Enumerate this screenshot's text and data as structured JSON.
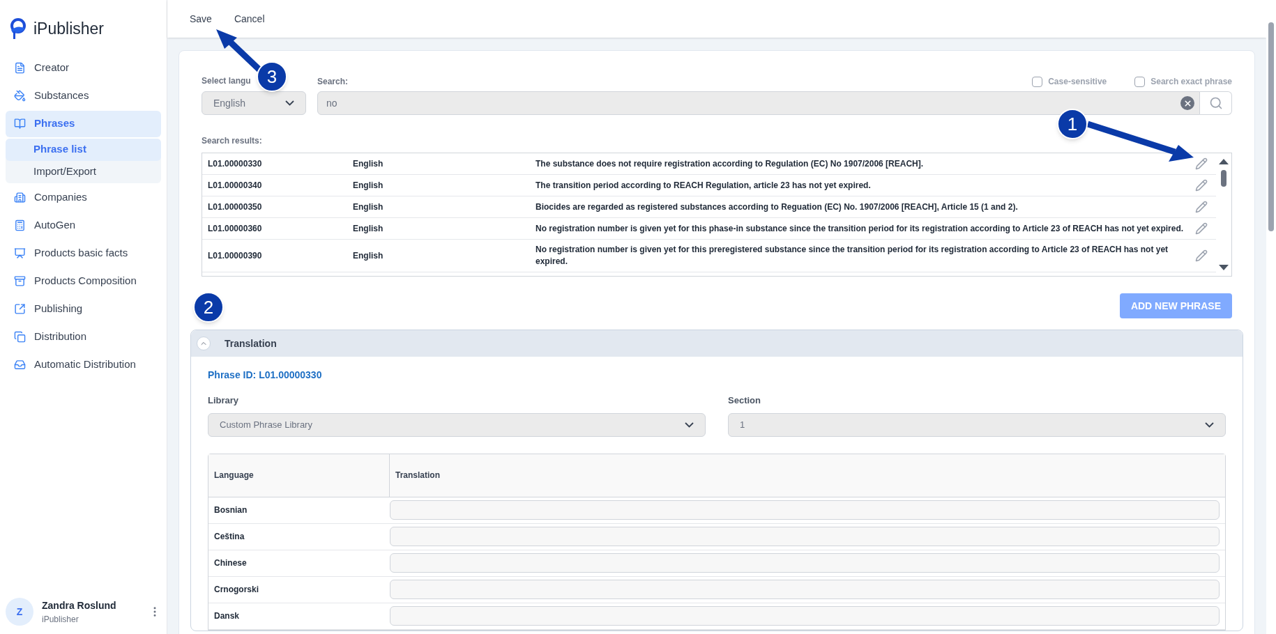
{
  "sidebar": {
    "logo": "iPublisher",
    "items": [
      {
        "label": "Creator",
        "selected": false
      },
      {
        "label": "Substances",
        "selected": false
      },
      {
        "label": "Phrases",
        "selected": true,
        "children": [
          {
            "label": "Phrase list",
            "selected": true
          },
          {
            "label": "Import/Export",
            "selected": false
          }
        ]
      },
      {
        "label": "Companies",
        "selected": false
      },
      {
        "label": "AutoGen",
        "selected": false
      },
      {
        "label": "Products basic facts",
        "selected": false
      },
      {
        "label": "Products Composition",
        "selected": false
      },
      {
        "label": "Publishing",
        "selected": false
      },
      {
        "label": "Distribution",
        "selected": false
      },
      {
        "label": "Automatic Distribution",
        "selected": false
      }
    ],
    "user": {
      "initial": "Z",
      "name": "Zandra Roslund",
      "org": "iPublisher"
    }
  },
  "toolbar": [
    "Save",
    "Cancel"
  ],
  "search": {
    "language_label": "Select langu",
    "language": "English",
    "search_label": "Search:",
    "value": "no",
    "options": [
      {
        "label": "Case-sensitive",
        "checked": false
      },
      {
        "label": "Search exact phrase",
        "checked": false
      }
    ]
  },
  "results": {
    "label": "Search results:",
    "rows": [
      {
        "id": "L01.00000330",
        "language": "English",
        "text": "The substance does not require registration according to Regulation (EC) No 1907/2006 [REACH]."
      },
      {
        "id": "L01.00000340",
        "language": "English",
        "text": "The transition period according to REACH Regulation, article 23 has not yet expired."
      },
      {
        "id": "L01.00000350",
        "language": "English",
        "text": "Biocides are regarded as registered substances according to Reguation (EC) No. 1907/2006 [REACH], Article 15 (1 and 2)."
      },
      {
        "id": "L01.00000360",
        "language": "English",
        "text": "No registration number is given yet for this phase-in substance since the transition period for its registration according to Article 23 of REACH has not yet expired."
      },
      {
        "id": "L01.00000390",
        "language": "English",
        "text": "No registration number is given yet for this preregistered substance since the transition period for its registration according to Article 23 of REACH has not yet expired."
      }
    ]
  },
  "add_button": "ADD NEW PHRASE",
  "translation": {
    "title": "Translation",
    "expanded": true,
    "phrase_id": "Phrase ID: L01.00000330",
    "library_label": "Library",
    "library": "Custom Phrase Library",
    "section_label": "Section",
    "section": "1",
    "columns": [
      "Language",
      "Translation"
    ],
    "rows": [
      "Bosnian",
      "Ceština",
      "Chinese",
      "Crnogorski",
      "Dansk"
    ]
  },
  "annotations": [
    {
      "number": "1",
      "arrow": true
    },
    {
      "number": "2",
      "arrow": false
    },
    {
      "number": "3",
      "arrow": true
    }
  ]
}
